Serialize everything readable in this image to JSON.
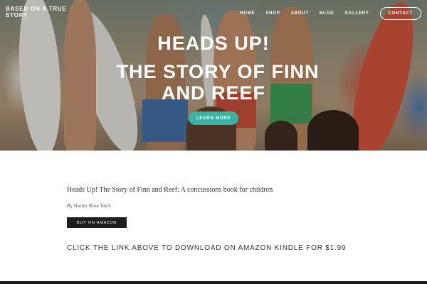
{
  "header": {
    "brand": "BASED ON A TRUE STORY",
    "nav": [
      "HOME",
      "SHOP",
      "ABOUT",
      "BLOG",
      "GALLERY"
    ],
    "contact": "CONTACT"
  },
  "hero": {
    "title_line1": "HEADS UP!",
    "title_line2": "THE STORY OF FINN",
    "title_line3": "AND REEF",
    "cta": "LEARN MORE",
    "cta_color": "#3ab3a7"
  },
  "content": {
    "title": "Heads Up! The Story of Finn and Reef: A concussions book for children",
    "author": "By Harley Rose Taich",
    "button": "BUY ON AMAZON",
    "note": "CLICK THE LINK ABOVE TO DOWNLOAD ON AMAZON KINDLE FOR $1.99"
  }
}
